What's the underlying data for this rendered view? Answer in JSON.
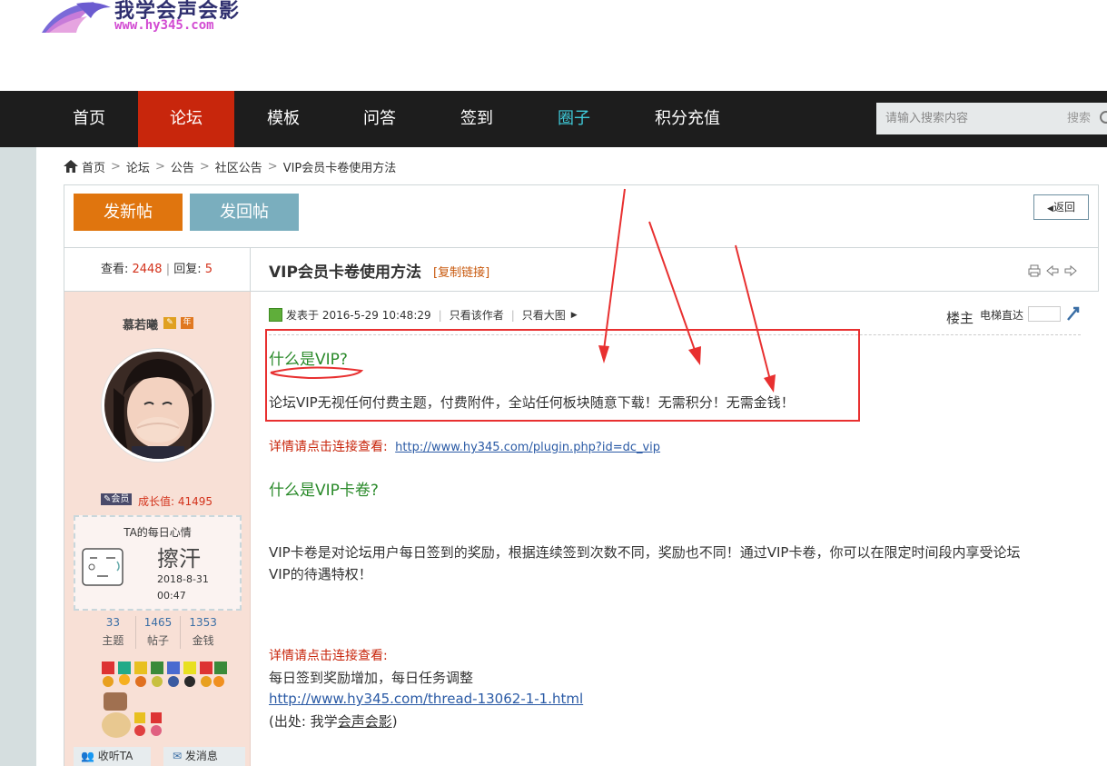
{
  "site": {
    "name": "我学会声会影",
    "url": "www.hy345.com"
  },
  "nav": {
    "items": [
      {
        "label": "首页"
      },
      {
        "label": "论坛"
      },
      {
        "label": "模板"
      },
      {
        "label": "问答"
      },
      {
        "label": "签到"
      },
      {
        "label": "圈子"
      },
      {
        "label": "积分充值"
      }
    ],
    "search_placeholder": "请输入搜索内容",
    "search_button": "搜索"
  },
  "breadcrumb": [
    "首页",
    "论坛",
    "公告",
    "社区公告",
    "VIP会员卡卷使用方法"
  ],
  "actions": {
    "new_post": "发新帖",
    "reply": "发回帖",
    "back": "返回"
  },
  "thread": {
    "views_label": "查看",
    "views": "2448",
    "replies_label": "回复",
    "replies": "5",
    "title": "VIP会员卡卷使用方法",
    "copy_link": "[复制链接]"
  },
  "user": {
    "name": "慕若曦",
    "member_label": "会员",
    "growth_label": "成长值:",
    "growth_value": "41495",
    "mood_title": "TA的每日心情",
    "mood_word": "擦汗",
    "mood_date": "2018-8-31",
    "mood_time": "00:47",
    "stats": [
      {
        "num": "33",
        "label": "主题"
      },
      {
        "num": "1465",
        "label": "帖子"
      },
      {
        "num": "1353",
        "label": "金钱"
      }
    ],
    "follow": "收听TA",
    "message": "发消息"
  },
  "post": {
    "posted_at": "发表于 2016-5-29 10:48:29",
    "only_author": "只看该作者",
    "only_big_image": "只看大图",
    "floor": "楼主",
    "elevator": "电梯直达",
    "h1": "什么是VIP?",
    "p1": "论坛VIP无视任何付费主题，付费附件，全站任何板块随意下载！无需积分！无需金钱！",
    "detail_label_1": "详情请点击连接查看:",
    "link_1": "http://www.hy345.com/plugin.php?id=dc_vip",
    "h2": "什么是VIP卡卷?",
    "p2_line1": "VIP卡卷是对论坛用户每日签到的奖励，根据连续签到次数不同，奖励也不同！通过VIP卡卷，你可以在限定时间段内享受论坛",
    "p2_line2": "VIP的待遇特权！",
    "detail_label_2": "详情请点击连接查看:",
    "p3": "每日签到奖励增加，每日任务调整",
    "link_2": "http://www.hy345.com/thread-13062-1-1.html",
    "source_prefix": "(出处: 我学",
    "source_link": "会声会影",
    "source_suffix": ")"
  }
}
